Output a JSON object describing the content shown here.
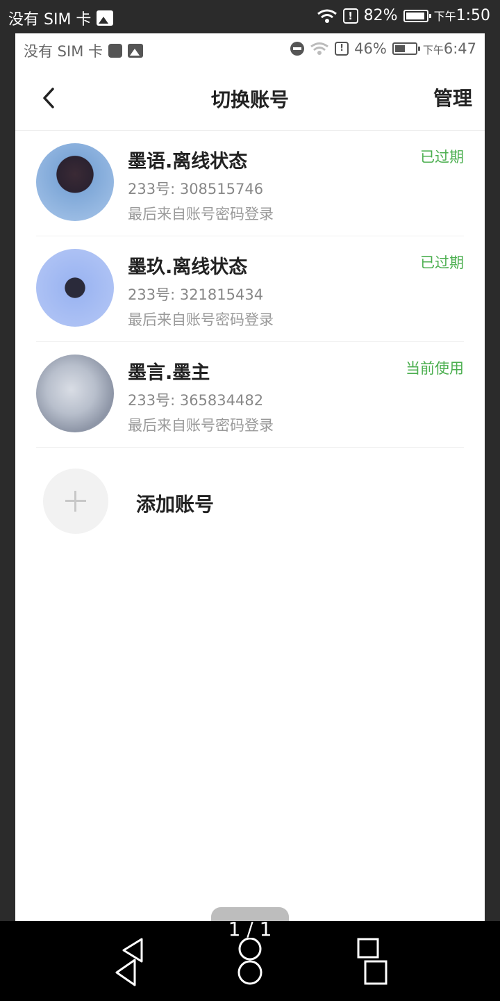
{
  "outer_status": {
    "carrier": "没有 SIM 卡",
    "battery": "82%",
    "ampm": "下午",
    "time": "1:50",
    "battery_level": 0.82
  },
  "inner_status": {
    "carrier": "没有 SIM 卡",
    "battery": "46%",
    "ampm": "下午",
    "time": "6:47",
    "battery_level": 0.46
  },
  "nav": {
    "title": "切换账号",
    "manage_label": "管理"
  },
  "accounts": [
    {
      "name": "墨语.离线状态",
      "id": "233号: 308515746",
      "login": "最后来自账号密码登录",
      "status": "已过期"
    },
    {
      "name": "墨玖.离线状态",
      "id": "233号: 321815434",
      "login": "最后来自账号密码登录",
      "status": "已过期"
    },
    {
      "name": "墨言.墨主",
      "id": "233号: 365834482",
      "login": "最后来自账号密码登录",
      "status": "当前使用"
    }
  ],
  "add_account": {
    "label": "添加账号"
  },
  "pager": "1 / 1",
  "colors": {
    "status_green": "#4caf50",
    "text_dark": "#222222",
    "text_gray": "#888888"
  }
}
